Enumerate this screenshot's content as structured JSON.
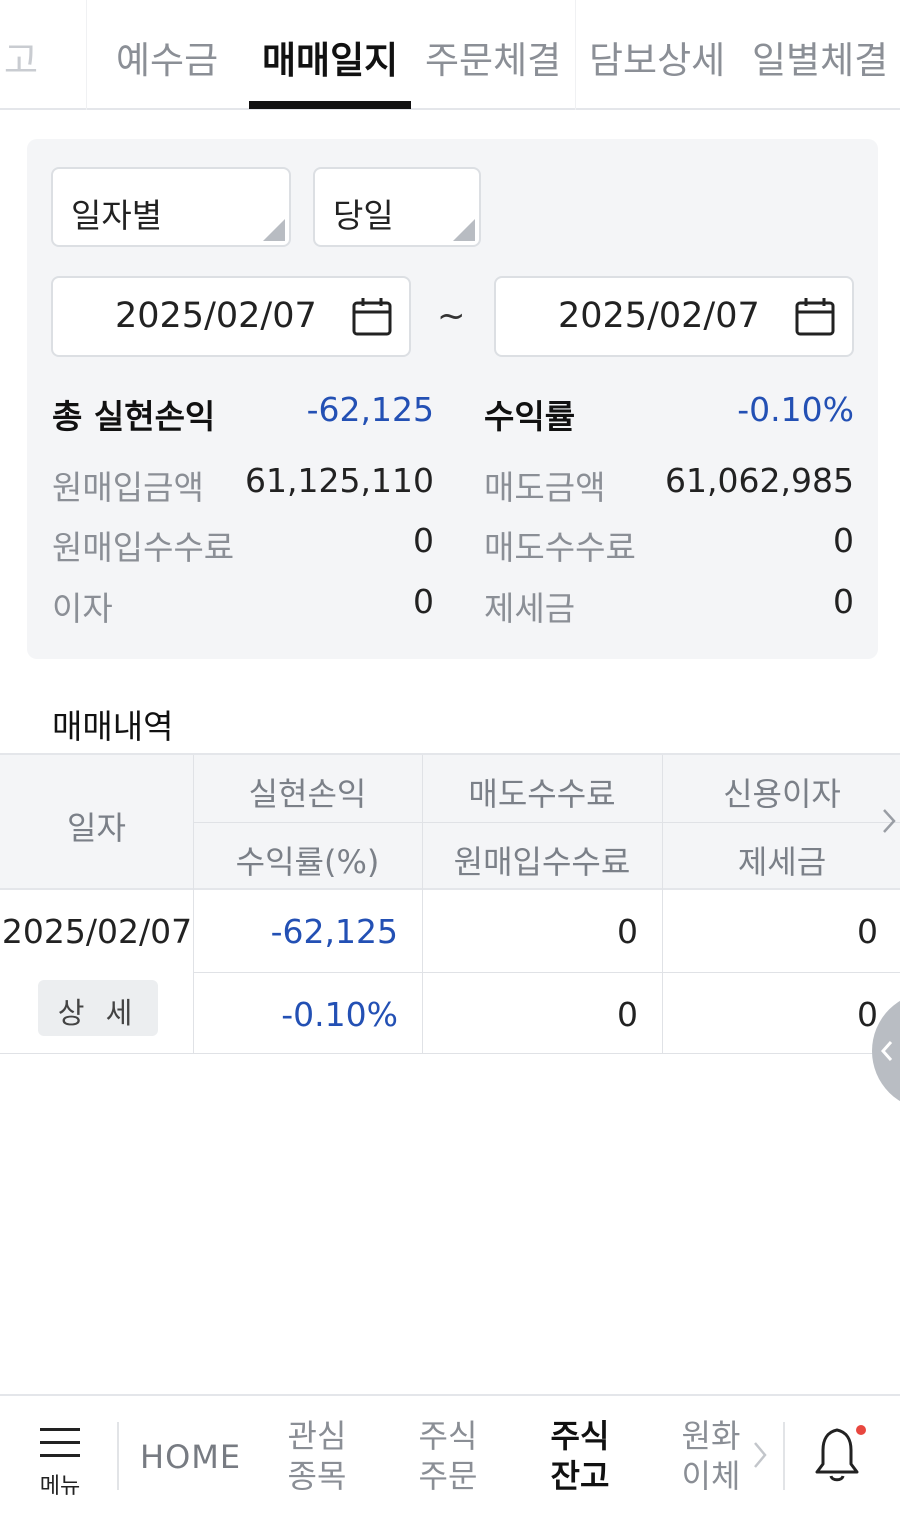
{
  "tabs": {
    "partial_left": "고",
    "items": [
      "예수금",
      "매매일지",
      "주문체결",
      "담보상세",
      "일별체결"
    ],
    "active_index": 1
  },
  "filter": {
    "period_type": "일자별",
    "period_range": "당일",
    "start_date": "2025/02/07",
    "end_date": "2025/02/07",
    "separator": "~"
  },
  "summary": {
    "total_profit_label": "총 실현손익",
    "total_profit_value": "-62,125",
    "return_rate_label": "수익률",
    "return_rate_value": "-0.10%",
    "rows": [
      {
        "left_label": "원매입금액",
        "left_value": "61,125,110",
        "right_label": "매도금액",
        "right_value": "61,062,985"
      },
      {
        "left_label": "원매입수수료",
        "left_value": "0",
        "right_label": "매도수수료",
        "right_value": "0"
      },
      {
        "left_label": "이자",
        "left_value": "0",
        "right_label": "제세금",
        "right_value": "0"
      }
    ]
  },
  "trades": {
    "title": "매매내역",
    "headers": {
      "date": "일자",
      "col1_top": "실현손익",
      "col1_bottom": "수익률(%)",
      "col2_top": "매도수수료",
      "col2_bottom": "원매입수수료",
      "col3_top": "신용이자",
      "col3_bottom": "제세금"
    },
    "rows": [
      {
        "date": "2025/02/07",
        "detail_label": "상 세",
        "realized_profit": "-62,125",
        "return_rate": "-0.10%",
        "sell_fee": "0",
        "buy_fee": "0",
        "credit_interest": "0",
        "tax": "0"
      }
    ]
  },
  "bottom_nav": {
    "menu_label": "메뉴",
    "home_label": "HOME",
    "items": [
      {
        "line1": "관심",
        "line2": "종목"
      },
      {
        "line1": "주식",
        "line2": "주문"
      },
      {
        "line1": "주식",
        "line2": "잔고"
      },
      {
        "line1": "원화",
        "line2": "이체"
      }
    ],
    "active_index": 2
  },
  "colors": {
    "negative_blue": "#2350b4",
    "panel_bg": "#f4f5f7",
    "notification_dot": "#e8473f"
  }
}
